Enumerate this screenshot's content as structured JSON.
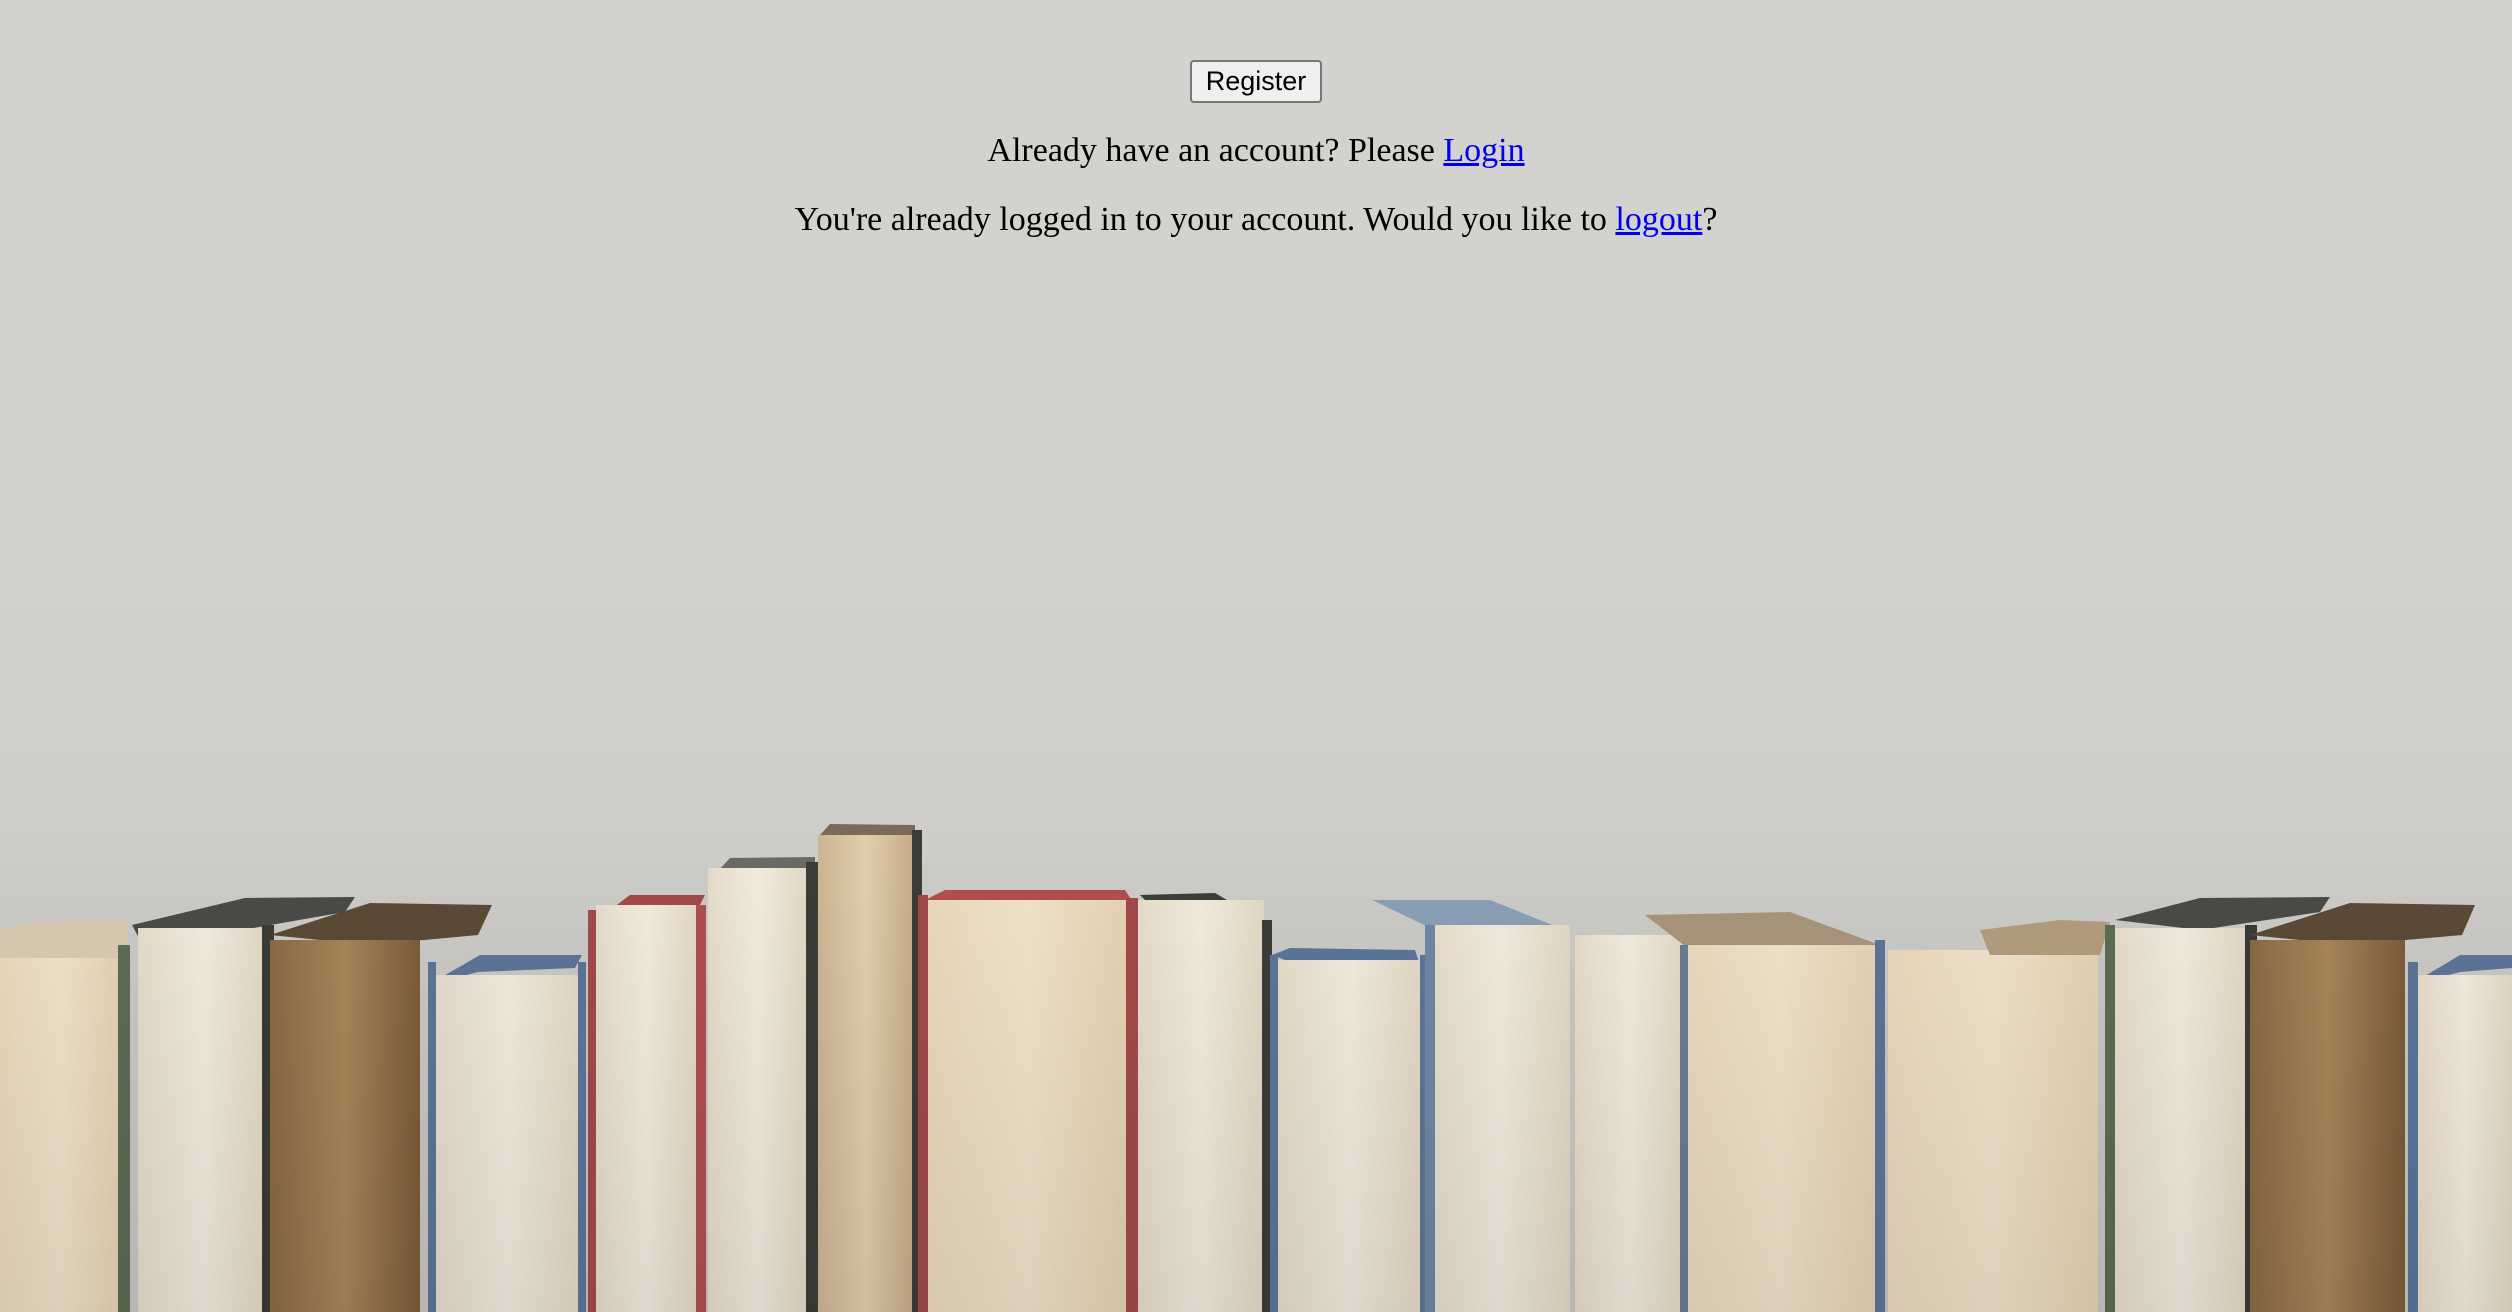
{
  "register": {
    "label": "Register"
  },
  "login_prompt": {
    "text": "Already have an account? Please ",
    "link": "Login"
  },
  "logout_prompt": {
    "text": "You're already logged in to your account. Would you like to ",
    "link": "logout",
    "suffix": "?"
  },
  "colors": {
    "background": "#d2d1cd",
    "link": "#0000ee"
  }
}
